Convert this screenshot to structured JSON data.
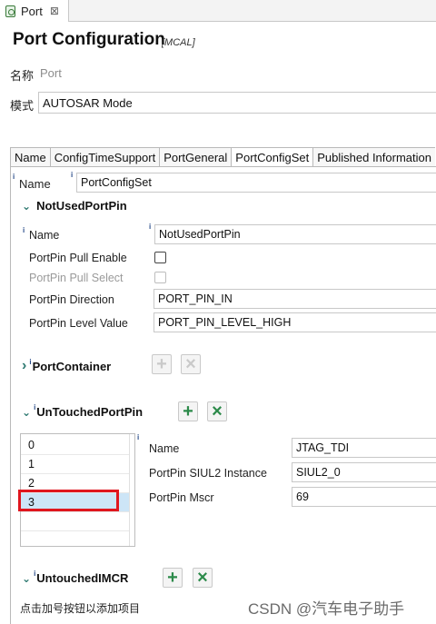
{
  "editor_tab": {
    "label": "Port",
    "close": "⊠"
  },
  "header": {
    "title": "Port Configuration",
    "subtitle": "[MCAL]"
  },
  "general": {
    "name_label": "名称",
    "name_value": "Port",
    "mode_label": "模式",
    "mode_value": "AUTOSAR Mode"
  },
  "tabs": [
    {
      "label": "Name",
      "active": false
    },
    {
      "label": "ConfigTimeSupport",
      "active": false
    },
    {
      "label": "PortGeneral",
      "active": false
    },
    {
      "label": "PortConfigSet",
      "active": true
    },
    {
      "label": "Published Information",
      "active": false
    }
  ],
  "config_set": {
    "name_label": "Name",
    "name_value": "PortConfigSet"
  },
  "not_used_pin": {
    "title": "NotUsedPortPin",
    "name_label": "Name",
    "name_value": "NotUsedPortPin",
    "pull_enable_label": "PortPin Pull Enable",
    "pull_select_label": "PortPin Pull Select",
    "direction_label": "PortPin Direction",
    "direction_value": "PORT_PIN_IN",
    "level_label": "PortPin Level Value",
    "level_value": "PORT_PIN_LEVEL_HIGH"
  },
  "port_container": {
    "title": "PortContainer"
  },
  "untouched_pin": {
    "title": "UnTouchedPortPin",
    "items": [
      "0",
      "1",
      "2",
      "3"
    ],
    "selected_index": 3,
    "name_label": "Name",
    "name_value": "JTAG_TDI",
    "siul_label": "PortPin SIUL2 Instance",
    "siul_value": "SIUL2_0",
    "mscr_label": "PortPin Mscr",
    "mscr_value": "69"
  },
  "untouched_imcr": {
    "title": "UntouchedIMCR"
  },
  "footer": {
    "hint": "点击加号按钮以添加项目"
  },
  "watermark": "CSDN @汽车电子助手",
  "glyphs": {
    "plus": "+",
    "cross": "×",
    "chevron_down": "⌄",
    "chevron_right": "›",
    "info": "i"
  },
  "colors": {
    "accent_green": "#2c8a4a",
    "chevron": "#2f7a72",
    "selection": "#cde5f7",
    "highlight_red": "#e0161e"
  }
}
